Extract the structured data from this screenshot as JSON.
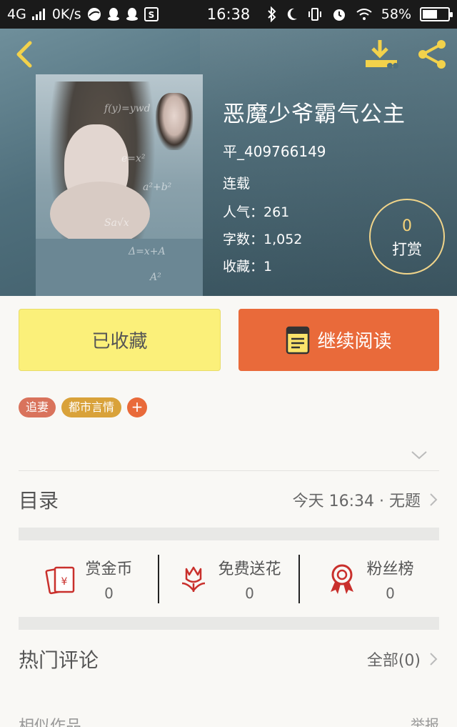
{
  "status_bar": {
    "network": "4G",
    "speed": "0K/s",
    "time": "16:38",
    "battery": "58%",
    "battery_level": 0.58,
    "icons": [
      "signal-icon",
      "browser-icon",
      "qq-icon",
      "qq-icon",
      "s-icon",
      "bluetooth-icon",
      "moon-icon",
      "vibrate-icon",
      "alarm-icon",
      "wifi-icon",
      "battery-icon"
    ]
  },
  "header": {
    "back_icon": "chevron-left-icon",
    "download_icon": "download-icon",
    "share_icon": "share-icon",
    "accent_color": "#f3d24b"
  },
  "book": {
    "title": "恶魔少爷霸气公主",
    "author": "平_409766149",
    "status": "连载",
    "popularity": "人气：261",
    "word_count": "字数：1,052",
    "favorites": "收藏：1"
  },
  "reward": {
    "count": "0",
    "label": "打赏"
  },
  "actions": {
    "saved_label": "已收藏",
    "read_label": "继续阅读",
    "saved_color": "#fbf07a",
    "read_color": "#e96a3a"
  },
  "tags": {
    "items": [
      "追妻",
      "都市言情"
    ],
    "add_label": "+"
  },
  "toc": {
    "label": "目录",
    "latest": "今天 16:34 · 无题"
  },
  "panel": {
    "items": [
      {
        "label": "赏金币",
        "value": "0",
        "icon": "red-envelope-icon"
      },
      {
        "label": "免费送花",
        "value": "0",
        "icon": "flower-icon"
      },
      {
        "label": "粉丝榜",
        "value": "0",
        "icon": "ribbon-medal-icon"
      }
    ]
  },
  "comments": {
    "label": "热门评论",
    "all": "全部(0)"
  },
  "similar": {
    "label": "相似作品",
    "report": "举报"
  }
}
